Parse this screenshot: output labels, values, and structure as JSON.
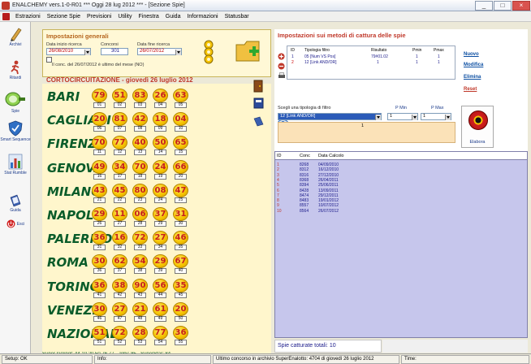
{
  "window": {
    "title": "ENALCHEMY vers.1-0-R01  ***  Oggi 28 lug 2012  ***  - [Sezione Spie]"
  },
  "menu": [
    "Estrazioni",
    "Sezione Spie",
    "Previsioni",
    "Utility",
    "Finestra",
    "Guida",
    "Informazioni",
    "Statusbar"
  ],
  "sidebar": [
    {
      "label": "Archivi",
      "icon": "pencil-icon"
    },
    {
      "label": "Ritardi",
      "icon": "running-man-icon"
    },
    {
      "label": "Spie",
      "icon": "spy-glass-icon"
    },
    {
      "label": "Smart Sequence",
      "icon": "shield-icon"
    },
    {
      "label": "Stat Rumble",
      "icon": "bar-chart-icon"
    },
    {
      "label": "Guida",
      "icon": "book-icon"
    },
    {
      "label": "Esci",
      "icon": "exit-icon"
    }
  ],
  "general": {
    "title": "Impostazioni generali",
    "date_start_label": "Data inizio ricerca",
    "date_start": "26/08/2010",
    "concorsi_label": "Concorsi",
    "concorsi": "301",
    "date_end_label": "Data fine ricerca",
    "date_end": "26/07/2012",
    "notice": "Il conc. del 26/07/2012 è ultimo del mese (NO)"
  },
  "cortocircuitazione": {
    "title": "CORTOCIRCUITAZIONE - giovedì 26 luglio 2012",
    "ruote": [
      {
        "name": "BARI",
        "numbers": [
          "79",
          "51",
          "83",
          "26",
          "63"
        ],
        "ord": [
          "01",
          "02",
          "03",
          "04",
          "05"
        ]
      },
      {
        "name": "CAGLIARI",
        "numbers": [
          "20",
          "81",
          "42",
          "18",
          "04"
        ],
        "ord": [
          "06",
          "07",
          "08",
          "09",
          "10"
        ]
      },
      {
        "name": "FIRENZE",
        "numbers": [
          "70",
          "77",
          "40",
          "50",
          "65"
        ],
        "ord": [
          "11",
          "12",
          "13",
          "14",
          "15"
        ]
      },
      {
        "name": "GENOVA",
        "numbers": [
          "49",
          "34",
          "70",
          "24",
          "66"
        ],
        "ord": [
          "16",
          "17",
          "18",
          "19",
          "20"
        ]
      },
      {
        "name": "MILANO",
        "numbers": [
          "43",
          "45",
          "80",
          "08",
          "47"
        ],
        "ord": [
          "21",
          "22",
          "23",
          "24",
          "25"
        ]
      },
      {
        "name": "NAPOLI",
        "numbers": [
          "29",
          "11",
          "06",
          "37",
          "31"
        ],
        "ord": [
          "26",
          "27",
          "28",
          "29",
          "30"
        ]
      },
      {
        "name": "PALERMO",
        "numbers": [
          "36",
          "16",
          "72",
          "27",
          "46"
        ],
        "ord": [
          "31",
          "32",
          "33",
          "34",
          "35"
        ]
      },
      {
        "name": "ROMA",
        "numbers": [
          "30",
          "62",
          "54",
          "29",
          "67"
        ],
        "ord": [
          "36",
          "37",
          "38",
          "39",
          "40"
        ]
      },
      {
        "name": "TORINO",
        "numbers": [
          "36",
          "38",
          "90",
          "56",
          "35"
        ],
        "ord": [
          "41",
          "42",
          "43",
          "44",
          "45"
        ]
      },
      {
        "name": "VENEZIA",
        "numbers": [
          "30",
          "27",
          "21",
          "61",
          "20"
        ],
        "ord": [
          "46",
          "47",
          "48",
          "49",
          "50"
        ]
      },
      {
        "name": "NAZIONALE",
        "numbers": [
          "51",
          "72",
          "28",
          "77",
          "36"
        ],
        "ord": [
          "51",
          "52",
          "53",
          "54",
          "55"
        ]
      }
    ],
    "footer": "SuperJackpot: 44 10 20 50 76 77 - Jolly: 85 - SuperStar: 84"
  },
  "methods": {
    "title": "Impostazioni sui metodi di cattura delle spie",
    "columns": [
      "ID",
      "Tipologia filtro",
      "Risultato",
      "Pmin",
      "Pmax"
    ],
    "rows": [
      {
        "id": "1",
        "tipo": "05 [Num VS Pos]",
        "ris": "79#01.02",
        "pmin": "1",
        "pmax": "1"
      },
      {
        "id": "2",
        "tipo": "12 [Link AND/OR]",
        "ris": "1",
        "pmin": "1",
        "pmax": "1"
      }
    ],
    "links": {
      "nuovo": "Nuovo",
      "modifica": "Modifica",
      "elimina": "Elimina",
      "reset": "Reset"
    },
    "filter_label": "Scegli una tipologia di filtro",
    "pmin_label": "P Min",
    "pmax_label": "P Max",
    "filter_value": "12 [Link AND/OR]",
    "pmin_value": "1",
    "pmax_value": "1",
    "param_value": "1",
    "elabora": "Elabora"
  },
  "results": {
    "columns": [
      "ID",
      "Conc",
      "Data Calcolo"
    ],
    "rows": [
      {
        "id": "1",
        "conc": "8268",
        "data": "04/09/2010"
      },
      {
        "id": "2",
        "conc": "8312",
        "data": "16/12/2010"
      },
      {
        "id": "3",
        "conc": "8316",
        "data": "27/12/2010"
      },
      {
        "id": "4",
        "conc": "8368",
        "data": "26/04/2011"
      },
      {
        "id": "5",
        "conc": "8394",
        "data": "25/06/2011"
      },
      {
        "id": "6",
        "conc": "8428",
        "data": "13/09/2011"
      },
      {
        "id": "7",
        "conc": "8474",
        "data": "29/12/2011"
      },
      {
        "id": "8",
        "conc": "8483",
        "data": "19/01/2012"
      },
      {
        "id": "9",
        "conc": "8557",
        "data": "10/07/2012"
      },
      {
        "id": "10",
        "conc": "8564",
        "data": "26/07/2012"
      }
    ],
    "total": "Spie catturate totali: 10"
  },
  "status": {
    "setup": "Setup: OK",
    "info": "Info:",
    "ultimo": "Ultimo concorso in archivio SuperEnalotto: 4704 di giovedì 26 luglio 2012",
    "time": "Time:"
  },
  "colors": {
    "accent": "#c0392b",
    "green": "#0a5c2a",
    "ball": "#f5c300",
    "results_bg": "#c6c6ec"
  }
}
